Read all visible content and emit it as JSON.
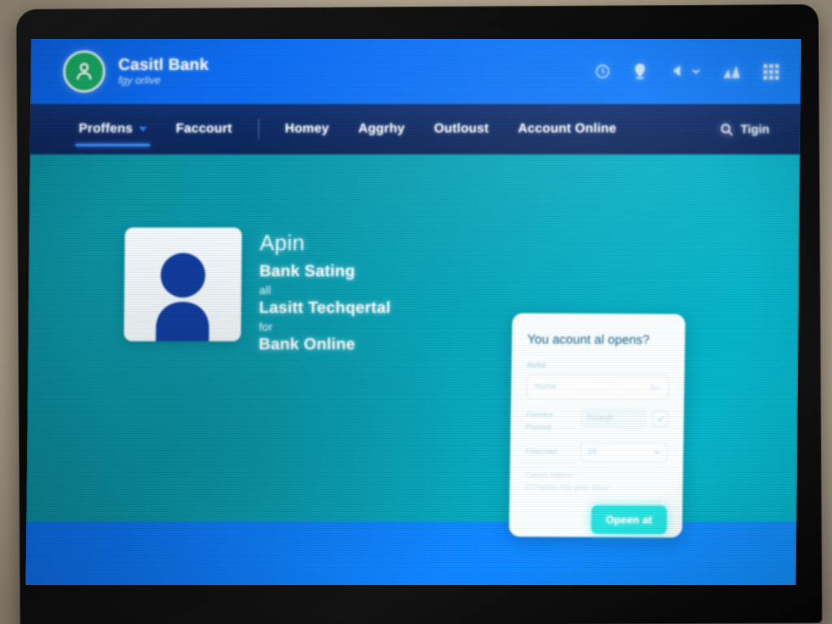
{
  "header": {
    "brand_name": "Casitl Bank",
    "brand_tagline": "fgy orlive",
    "logo_icon": "user-circle-icon",
    "icons": [
      {
        "name": "clock-icon",
        "glyph": "clock"
      },
      {
        "name": "location-pin-icon",
        "glyph": "pin"
      },
      {
        "name": "speaker-icon",
        "glyph": "speaker"
      },
      {
        "name": "chart-bars-icon",
        "glyph": "chart"
      },
      {
        "name": "grid-apps-icon",
        "glyph": "grid"
      }
    ]
  },
  "nav": {
    "items": [
      {
        "label": "Proffens",
        "active": true,
        "has_caret": true
      },
      {
        "label": "Faccourt",
        "active": false,
        "has_caret": false
      },
      {
        "label": "Homey",
        "active": false,
        "has_caret": false
      },
      {
        "label": "Aggrhy",
        "active": false,
        "has_caret": false
      },
      {
        "label": "Outloust",
        "active": false,
        "has_caret": false
      },
      {
        "label": "Account Online",
        "active": false,
        "has_caret": false
      }
    ],
    "search_label": "Tigin",
    "search_icon": "search-icon"
  },
  "hero": {
    "avatar_icon": "person-avatar-icon",
    "headline": "Apin",
    "line1": "Bank Sating",
    "line2": "all",
    "line3": "Lasitt Techqertal",
    "line4": "for",
    "line5": "Bank Online"
  },
  "card": {
    "title": "You acount al opens?",
    "name_label": "Nofid",
    "name_placeholder": "Name",
    "name_hint": "Ten",
    "row2_label_a": "Feehtre",
    "row2_label_b": "Pxcoep",
    "row2_value": "Sizargh",
    "checkbox_checked": true,
    "select_label": "Flescoed",
    "select_value": "10",
    "helper_line1": "Canofy helben",
    "helper_line2": "ETFeoout Hov yesy toloct",
    "cta_label": "Opeen at"
  },
  "colors": {
    "header_blue": "#0f72f6",
    "nav_navy": "#0d2760",
    "hero_teal_left": "#0a8c9c",
    "hero_teal_right": "#06b6cd",
    "footer_blue": "#0f86ff",
    "logo_green": "#18a763",
    "cta_cyan": "#25e3e0",
    "avatar_blue": "#103c9e",
    "card_white": "#fbfeff",
    "nav_underline": "#3f8dff"
  }
}
